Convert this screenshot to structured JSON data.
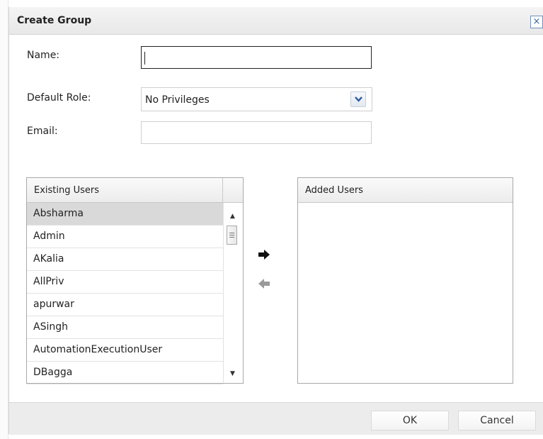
{
  "dialog": {
    "title": "Create Group",
    "close_glyph": "×"
  },
  "form": {
    "name_label": "Name:",
    "name_value": "",
    "role_label": "Default Role:",
    "role_value": "No Privileges",
    "email_label": "Email:",
    "email_value": ""
  },
  "existing_users": {
    "header": "Existing Users",
    "items": [
      "Absharma",
      "Admin",
      "AKalia",
      "AllPriv",
      "apurwar",
      "ASingh",
      "AutomationExecutionUser",
      "DBagga"
    ],
    "selected_index": 0
  },
  "added_users": {
    "header": "Added Users",
    "items": []
  },
  "icons": {
    "add": "arrow-right-icon",
    "remove": "arrow-left-icon",
    "dropdown": "chevron-down-icon",
    "close": "close-icon"
  },
  "footer": {
    "ok_label": "OK",
    "cancel_label": "Cancel"
  },
  "colors": {
    "close_accent": "#3a66a3",
    "selected_row": "#d9d9d9",
    "remove_arrow_disabled": "#9a9a9a"
  }
}
